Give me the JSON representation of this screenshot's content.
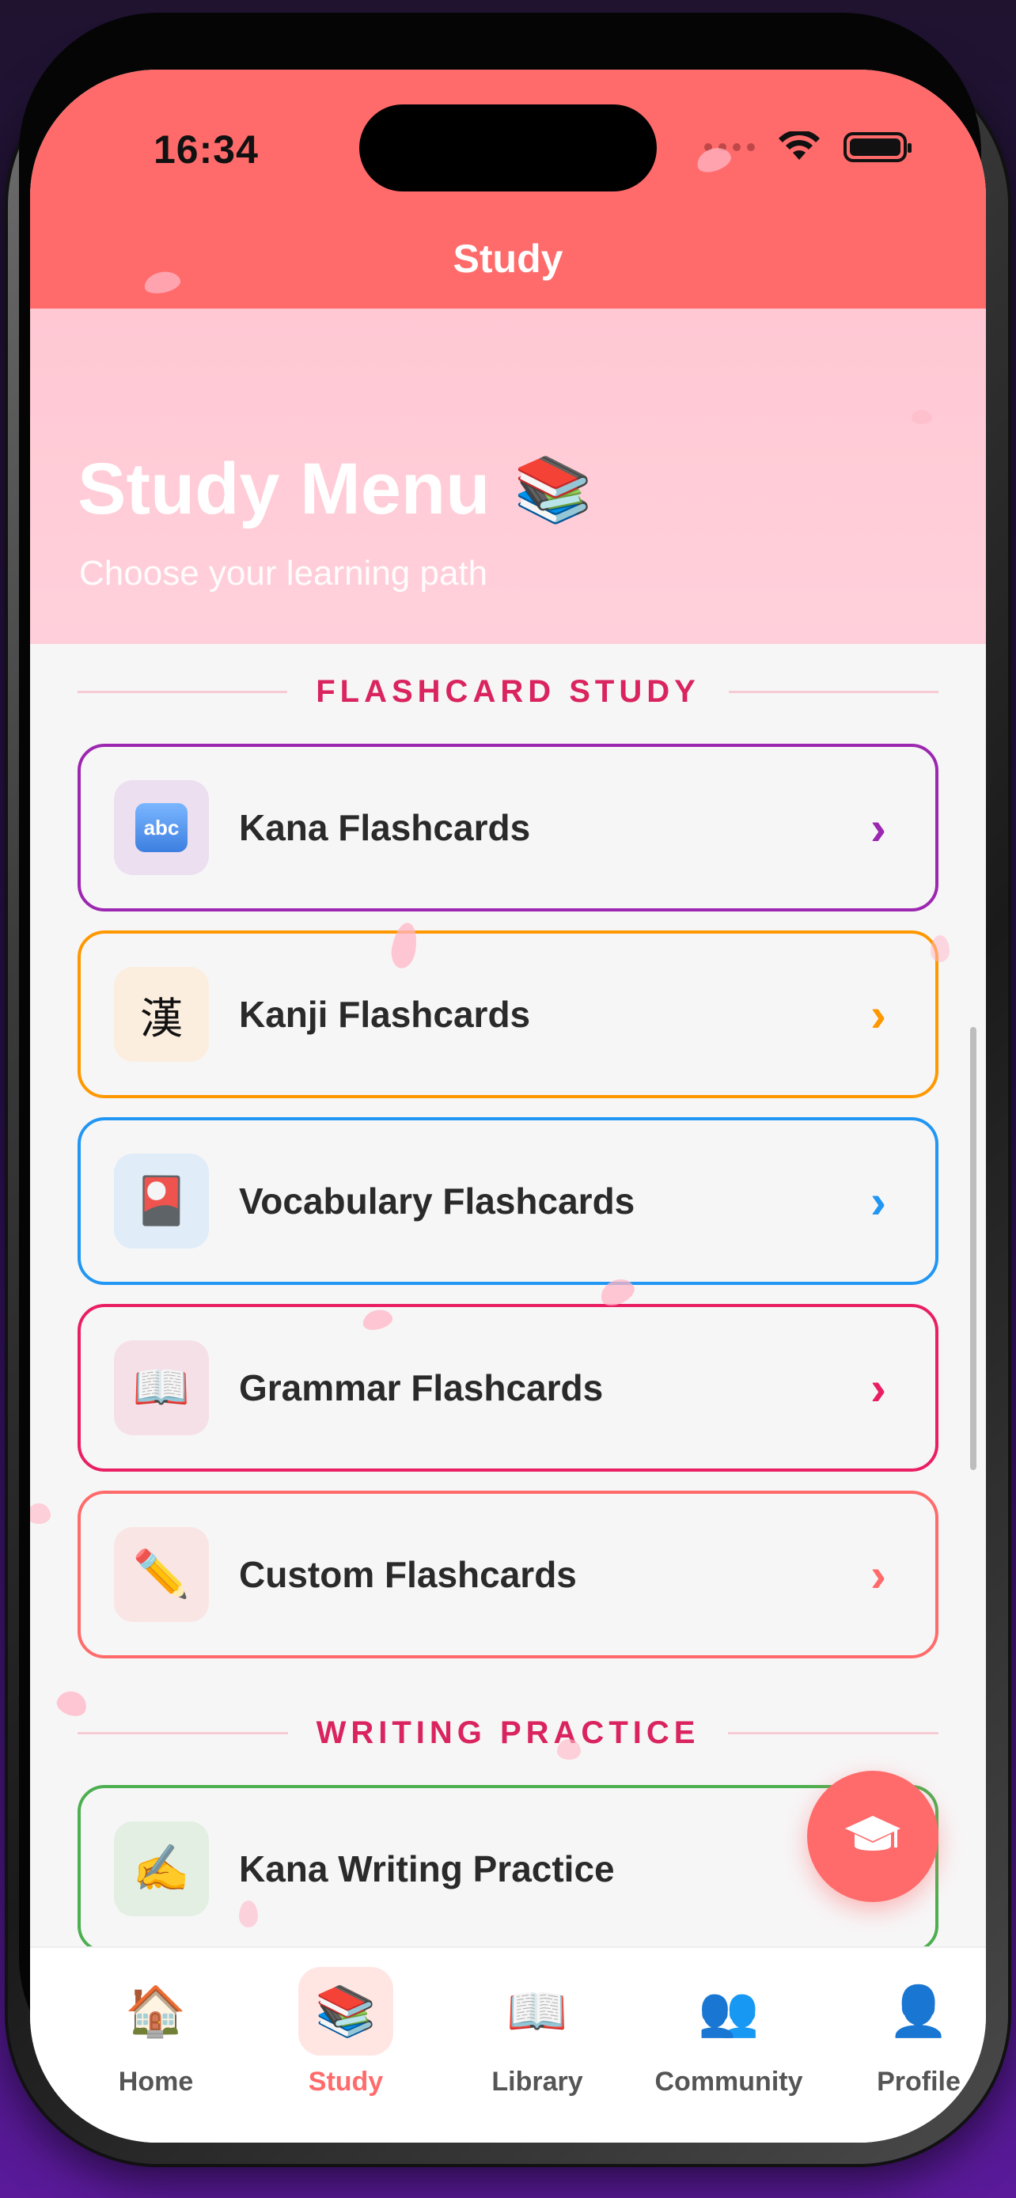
{
  "status": {
    "time": "16:34"
  },
  "header": {
    "title": "Study"
  },
  "hero": {
    "title": "Study Menu",
    "title_emoji": "📚",
    "subtitle": "Choose your learning path"
  },
  "sections": {
    "flashcards": {
      "heading": "FLASHCARD STUDY",
      "cards": [
        {
          "label": "Kana Flashcards",
          "icon": "abc-icon",
          "glyph": "abc",
          "accent": "#9c27b0",
          "tile": "#ecdff0"
        },
        {
          "label": "Kanji Flashcards",
          "icon": "kanji-icon",
          "glyph": "漢",
          "accent": "#ff9800",
          "tile": "#fbeedf"
        },
        {
          "label": "Vocabulary Flashcards",
          "icon": "red-card-icon",
          "glyph": "🎴",
          "accent": "#2196f3",
          "tile": "#e0ecf8"
        },
        {
          "label": "Grammar Flashcards",
          "icon": "open-book-icon",
          "glyph": "📖",
          "accent": "#e91e63",
          "tile": "#f6e0e8"
        },
        {
          "label": "Custom Flashcards",
          "icon": "pencil-icon",
          "glyph": "✏️",
          "accent": "#ff6b6b",
          "tile": "#fae5e5"
        }
      ]
    },
    "writing": {
      "heading": "WRITING PRACTICE",
      "cards": [
        {
          "label": "Kana Writing Practice",
          "icon": "writing-hand-icon",
          "glyph": "✍️",
          "accent": "#4caf50",
          "tile": "#e2efe2"
        }
      ]
    }
  },
  "fab": {
    "icon": "graduation-cap-icon"
  },
  "tabbar": {
    "items": [
      {
        "label": "Home",
        "icon": "house-icon",
        "glyph": "🏠",
        "active": false
      },
      {
        "label": "Study",
        "icon": "books-icon",
        "glyph": "📚",
        "active": true
      },
      {
        "label": "Library",
        "icon": "open-book-icon",
        "glyph": "📖",
        "active": false
      },
      {
        "label": "Community",
        "icon": "people-icon",
        "glyph": "👥",
        "active": false
      },
      {
        "label": "Profile",
        "icon": "person-icon",
        "glyph": "👤",
        "active": false
      }
    ]
  },
  "theme": {
    "primary": "#ff6b6b",
    "section_heading": "#d9245f"
  }
}
